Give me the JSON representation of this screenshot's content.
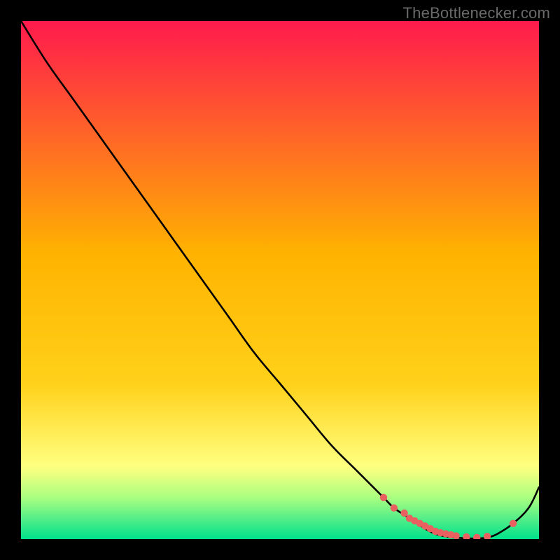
{
  "watermark": "TheBottlenecker.com",
  "colors": {
    "top": "#ff1a4d",
    "mid": "#ffd11a",
    "low1": "#ffff80",
    "low2": "#aaff80",
    "low3": "#55ee88",
    "low4": "#00e28a",
    "curve": "#000000",
    "marker": "#e86060"
  },
  "chart_data": {
    "type": "line",
    "title": "",
    "xlabel": "",
    "ylabel": "",
    "xlim": [
      0,
      100
    ],
    "ylim": [
      0,
      100
    ],
    "series": [
      {
        "name": "curve",
        "x": [
          0,
          5,
          10,
          15,
          20,
          25,
          30,
          35,
          40,
          45,
          50,
          55,
          60,
          65,
          70,
          72,
          75,
          78,
          80,
          82,
          85,
          88,
          90,
          92,
          95,
          98,
          100
        ],
        "y": [
          100,
          92,
          85,
          78,
          71,
          64,
          57,
          50,
          43,
          36,
          30,
          24,
          18,
          13,
          8,
          6,
          4,
          2,
          1,
          0.5,
          0.2,
          0.1,
          0.3,
          1.0,
          3.0,
          6.0,
          10
        ]
      }
    ],
    "markers": {
      "name": "red-dots",
      "x": [
        70,
        72,
        74,
        75,
        76,
        77,
        78,
        79,
        80,
        81,
        82,
        83,
        84,
        86,
        88,
        90,
        95
      ],
      "y": [
        8,
        6,
        5,
        4,
        3.5,
        3,
        2.5,
        2,
        1.5,
        1.2,
        1.0,
        0.8,
        0.6,
        0.4,
        0.3,
        0.5,
        3.0
      ]
    }
  }
}
